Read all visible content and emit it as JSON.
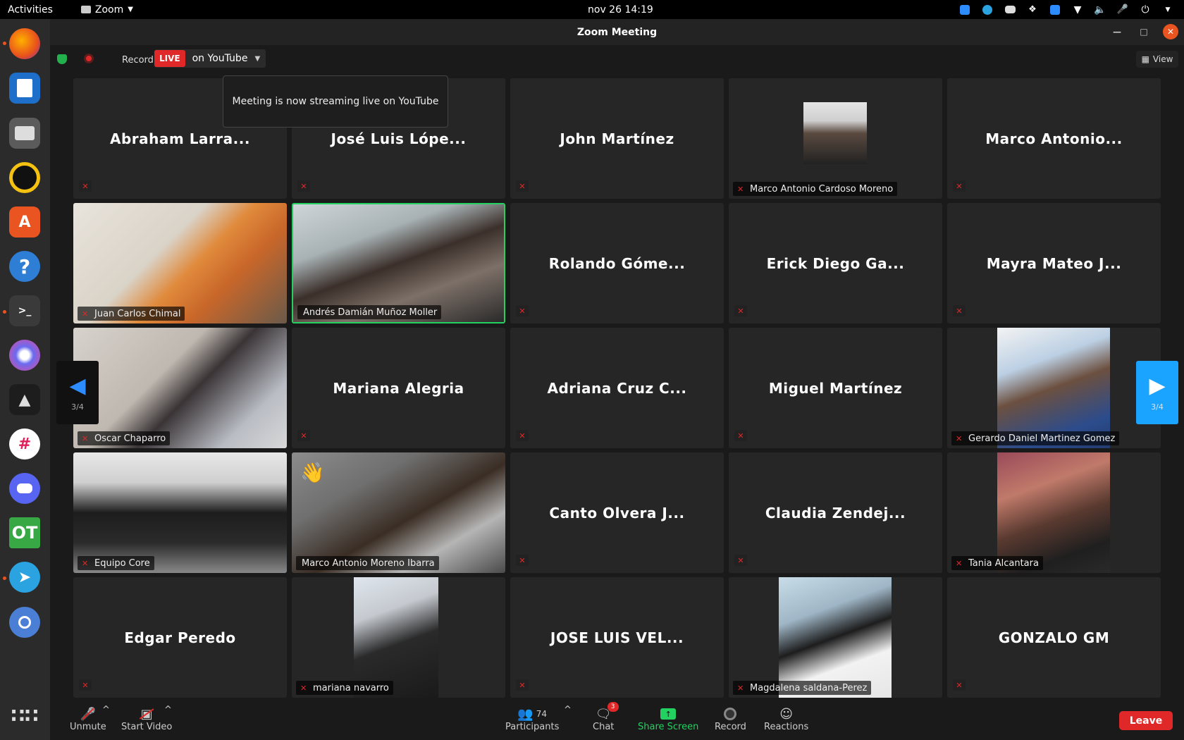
{
  "topbar": {
    "activities": "Activities",
    "app": "Zoom",
    "clock": "nov 26  14:19"
  },
  "window": {
    "title": "Zoom Meeting"
  },
  "meeting": {
    "recording_label": "Recording",
    "live_badge": "LIVE",
    "live_target": "on YouTube",
    "view_label": "View",
    "tooltip": "Meeting is now streaming live on YouTube"
  },
  "grid": {
    "page_left": "3/4",
    "page_right": "3/4",
    "tiles": [
      {
        "name": "Abraham Larra..."
      },
      {
        "name": "José Luis Lópe..."
      },
      {
        "name": "John Martínez"
      },
      {
        "name": "Marco Antonio Cardoso Moreno"
      },
      {
        "name": "Marco Antonio..."
      },
      {
        "name": "Juan Carlos Chimal"
      },
      {
        "name": "Andrés Damián Muñoz Moller"
      },
      {
        "name": "Rolando Góme..."
      },
      {
        "name": "Erick Diego Ga..."
      },
      {
        "name": "Mayra Mateo J..."
      },
      {
        "name": "Oscar Chaparro"
      },
      {
        "name": "Mariana Alegria"
      },
      {
        "name": "Adriana Cruz C..."
      },
      {
        "name": "Miguel Martínez"
      },
      {
        "name": "Gerardo Daniel Martinez Gomez"
      },
      {
        "name": "Equipo Core"
      },
      {
        "name": "Marco Antonio Moreno Ibarra"
      },
      {
        "name": "Canto Olvera J..."
      },
      {
        "name": "Claudia Zendej..."
      },
      {
        "name": "Tania Alcantara"
      },
      {
        "name": "Edgar Peredo"
      },
      {
        "name": "mariana navarro"
      },
      {
        "name": "JOSE LUIS VEL..."
      },
      {
        "name": "Magdalena saldana-Perez"
      },
      {
        "name": "GONZALO GM"
      }
    ]
  },
  "toolbar": {
    "unmute": "Unmute",
    "start_video": "Start Video",
    "participants": "Participants",
    "participants_count": "74",
    "chat": "Chat",
    "chat_badge": "3",
    "share_screen": "Share Screen",
    "record": "Record",
    "reactions": "Reactions",
    "leave": "Leave"
  },
  "colors": {
    "live_red": "#e02828",
    "share_green": "#23d160",
    "active_border": "#23d160",
    "ubuntu_orange": "#e95420"
  },
  "dock_icons": [
    "firefox-icon",
    "writer-icon",
    "files-icon",
    "rhythmbox-icon",
    "software-icon",
    "help-icon",
    "terminal-icon",
    "krita-icon",
    "inkscape-icon",
    "slack-icon",
    "discord-icon",
    "opentoonz-icon",
    "telegram-icon",
    "chromium-icon",
    "apps-grid-icon"
  ]
}
